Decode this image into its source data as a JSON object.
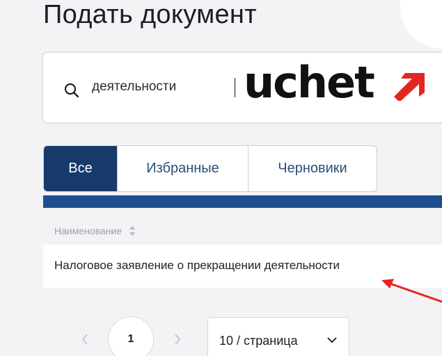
{
  "page": {
    "title": "Подать документ"
  },
  "search": {
    "value": "деятельности",
    "icon": "search-icon"
  },
  "logo": {
    "text": "uchet",
    "accent": "#e52521"
  },
  "tabs": [
    {
      "label": "Все",
      "active": true
    },
    {
      "label": "Избранные",
      "active": false
    },
    {
      "label": "Черновики",
      "active": false
    }
  ],
  "table": {
    "column_header": "Наименование",
    "rows": [
      {
        "name": "Налоговое заявление о прекращении деятельности"
      }
    ]
  },
  "pagination": {
    "current_page": "1",
    "page_size": "10 / страница"
  },
  "colors": {
    "primary": "#173a6a",
    "bar": "#1f4e8f",
    "annotation_arrow": "#e52521"
  }
}
